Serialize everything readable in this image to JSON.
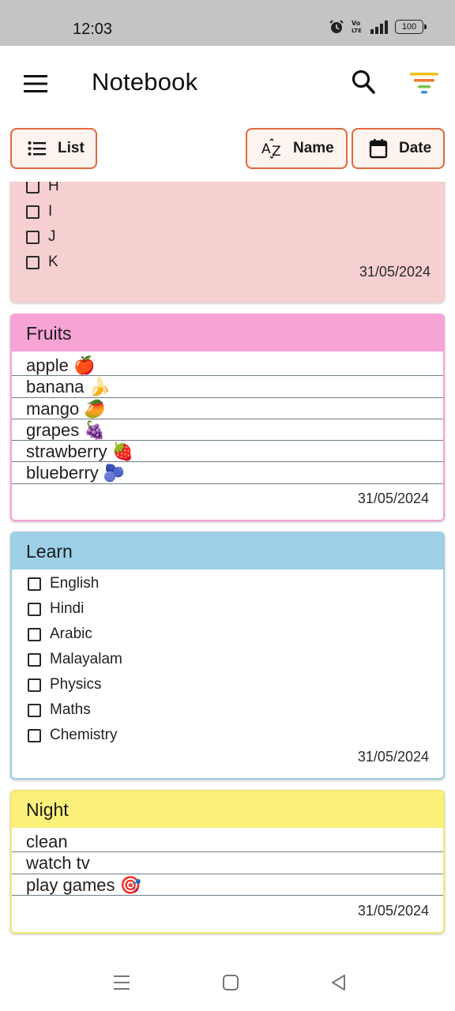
{
  "status_bar": {
    "time": "12:03",
    "battery": "100",
    "icons": [
      "alarm-icon",
      "volte-icon",
      "signal-icon",
      "battery-icon"
    ]
  },
  "app_bar": {
    "title": "Notebook",
    "icons": [
      "menu-icon",
      "search-icon",
      "filter-icon"
    ]
  },
  "toolbar": {
    "list_label": "List",
    "name_label": "Name",
    "date_label": "Date"
  },
  "notes": {
    "top": {
      "items": [
        "H",
        "I",
        "J",
        "K"
      ],
      "date": "31/05/2024",
      "color": "#f6cfd1"
    },
    "fruits": {
      "title": "Fruits",
      "lines": [
        "apple 🍎",
        "banana 🍌",
        "mango 🥭",
        "grapes 🍇",
        "strawberry 🍓",
        "blueberry 🫐"
      ],
      "date": "31/05/2024",
      "color": "#f7a3d6"
    },
    "learn": {
      "title": "Learn",
      "items": [
        "English",
        "Hindi",
        "Arabic",
        "Malayalam",
        "Physics",
        "Maths",
        "Chemistry"
      ],
      "date": "31/05/2024",
      "color": "#9dd0e6"
    },
    "night": {
      "title": "Night",
      "lines": [
        "clean",
        "watch tv",
        "play games 🎯"
      ],
      "date": "31/05/2024",
      "color": "#fbf07a"
    }
  },
  "nav_bar": {
    "icons": [
      "recent-apps-icon",
      "home-icon",
      "back-icon"
    ]
  }
}
